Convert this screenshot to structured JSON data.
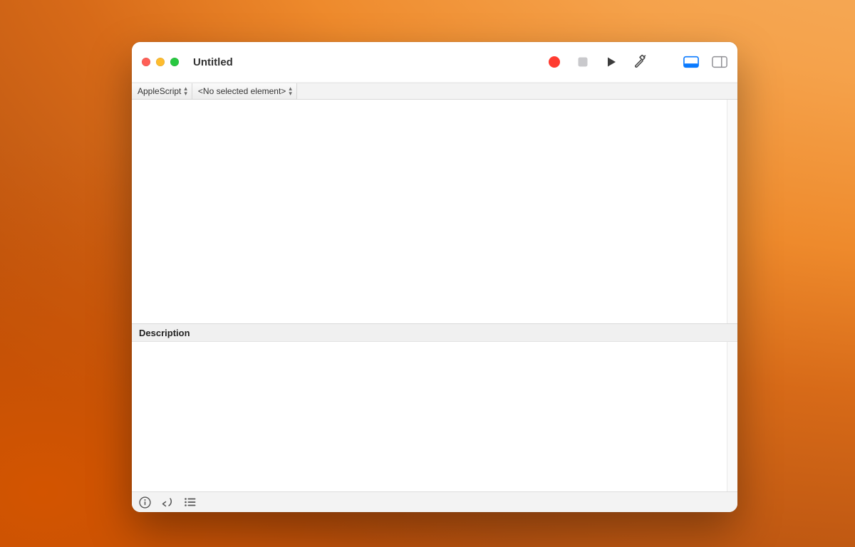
{
  "window": {
    "title": "Untitled"
  },
  "segbar": {
    "language": "AppleScript",
    "element": "<No selected element>"
  },
  "toolbar": {
    "record": "Record",
    "stop": "Stop",
    "run": "Run",
    "compile": "Compile",
    "log": "Show Log",
    "panel": "Toggle Side Panel"
  },
  "editor": {
    "content": ""
  },
  "description": {
    "header": "Description",
    "content": ""
  },
  "statusbar": {
    "accessibility": "Accessibility Inspector",
    "replies": "Replies",
    "events": "Events"
  },
  "colors": {
    "record": "#ff3b30",
    "disabled": "#8e8e93",
    "icon": "#4a4a4a",
    "accent": "#0a7aff"
  }
}
